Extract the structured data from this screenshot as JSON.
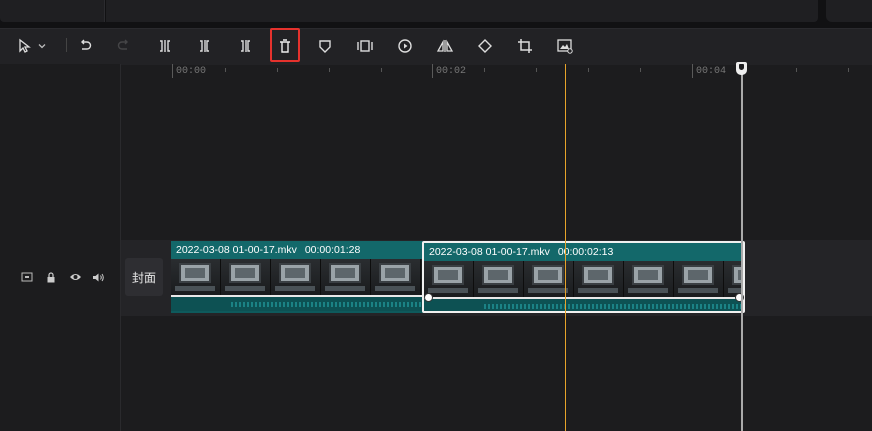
{
  "toolbar": {
    "items": [
      "select-tool",
      "select-dropdown",
      "undo",
      "redo",
      "split",
      "split-left",
      "split-right",
      "delete",
      "mark",
      "freeze",
      "reverse",
      "mirror",
      "rotate",
      "crop",
      "smart-cut"
    ]
  },
  "ruler": {
    "labels": [
      "00:00",
      "00:02",
      "00:04"
    ]
  },
  "track": {
    "cover_label": "封面",
    "clips": [
      {
        "name": "2022-03-08 01-00-17.mkv",
        "duration": "00:00:01:28"
      },
      {
        "name": "2022-03-08 01-00-17.mkv",
        "duration": "00:00:02:13"
      }
    ]
  },
  "colors": {
    "highlight": "#e5322d",
    "playhead": "#e6a32a",
    "clip": "#0e5a5c"
  }
}
